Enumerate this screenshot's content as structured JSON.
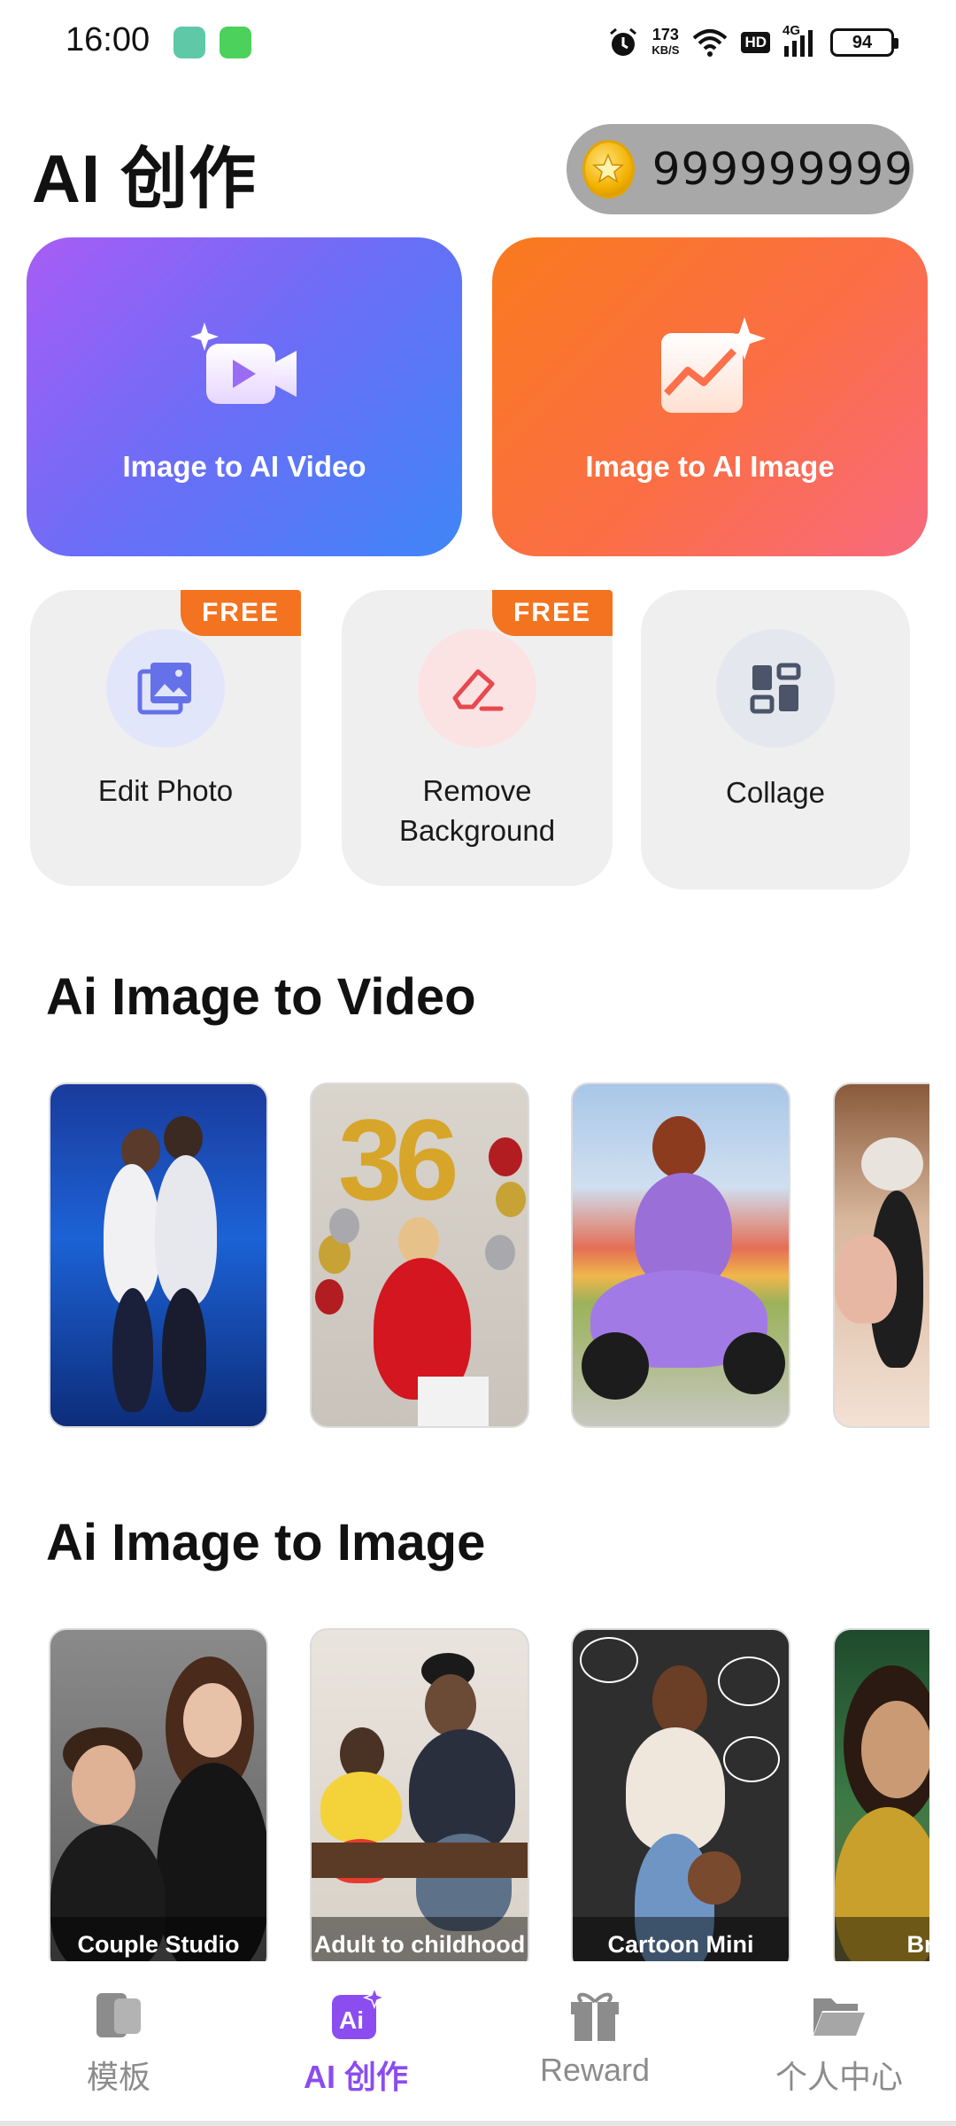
{
  "status_bar": {
    "time": "16:00",
    "net_speed_value": "173",
    "net_speed_unit": "KB/S",
    "hd": "HD",
    "signal": "4G",
    "battery": "94"
  },
  "header": {
    "title": "AI 创作",
    "coins": "999999999"
  },
  "hero_cards": [
    {
      "label": "Image to AI Video",
      "icon": "video-camera-sparkle-icon"
    },
    {
      "label": "Image to AI Image",
      "icon": "image-sparkle-icon"
    }
  ],
  "tools": [
    {
      "label": "Edit Photo",
      "badge": "FREE",
      "icon": "photo-gallery-icon"
    },
    {
      "label_line1": "Remove",
      "label_line2": "Background",
      "badge": "FREE",
      "icon": "eraser-icon"
    },
    {
      "label": "Collage",
      "icon": "grid-layout-icon"
    }
  ],
  "sections": {
    "video": {
      "title": "Ai Image to Video"
    },
    "image": {
      "title": "Ai Image to Image",
      "items": [
        "Couple Studio",
        "Adult to childhood",
        "Cartoon Mini",
        "Brazili"
      ]
    }
  },
  "bottom_nav": [
    {
      "label": "模板",
      "icon": "template-icon",
      "active": false
    },
    {
      "label": "AI 创作",
      "icon": "ai-create-icon",
      "active": true
    },
    {
      "label": "Reward",
      "icon": "gift-icon",
      "active": false
    },
    {
      "label": "个人中心",
      "icon": "folder-icon",
      "active": false
    }
  ],
  "colors": {
    "accent": "#8b4df0",
    "free_badge": "#f47320",
    "video_gradient": [
      "#a85cf5",
      "#3f86f7"
    ],
    "image_gradient": [
      "#f97a1e",
      "#f86a7e"
    ]
  }
}
